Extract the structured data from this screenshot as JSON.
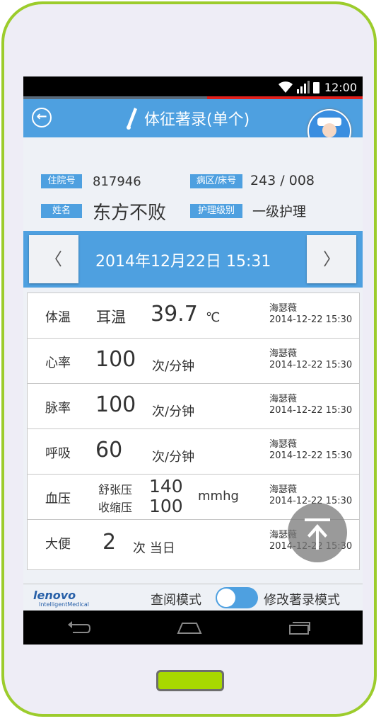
{
  "status": {
    "time": "12:00"
  },
  "header": {
    "title": "体征著录(单个)"
  },
  "patient": {
    "admission_label": "住院号",
    "admission_no": "817946",
    "ward_label": "病区/床号",
    "ward_bed": "243 / 008",
    "name_label": "姓名",
    "name": "东方不败",
    "care_label": "护理级别",
    "care_level": "一级护理"
  },
  "date_nav": {
    "prev": "〈",
    "next": "〉",
    "datetime": "2014年12月22日  15:31"
  },
  "vitals": [
    {
      "label": "体温",
      "method": "耳温",
      "value": "39.7",
      "unit": "℃",
      "recorder": "海瑟薇",
      "time": "2014-12-22 15:30"
    },
    {
      "label": "心率",
      "value": "100",
      "unit": "次/分钟",
      "recorder": "海瑟薇",
      "time": "2014-12-22 15:30"
    },
    {
      "label": "脉率",
      "value": "100",
      "unit": "次/分钟",
      "recorder": "海瑟薇",
      "time": "2014-12-22 15:30"
    },
    {
      "label": "呼吸",
      "value": "60",
      "unit": "次/分钟",
      "recorder": "海瑟薇",
      "time": "2014-12-22 15:30"
    },
    {
      "label": "血压",
      "systolic_label": "舒张压",
      "systolic": "140",
      "diastolic_label": "收缩压",
      "diastolic": "100",
      "unit": "mmhg",
      "recorder": "海瑟薇",
      "time": "2014-12-22 15:30"
    },
    {
      "label": "大便",
      "value": "2",
      "unit": "次 当日",
      "recorder": "海瑟薇",
      "time": "2014-12-22 15:30"
    }
  ],
  "footer": {
    "logo": "lenovo",
    "logo_sub": "IntelligentMedical",
    "mode_left": "查阅模式",
    "mode_right": "修改著录模式"
  },
  "colors": {
    "accent": "#4ea0e0",
    "phone_frame": "#9ccc2c",
    "home_button": "#a8d800"
  }
}
